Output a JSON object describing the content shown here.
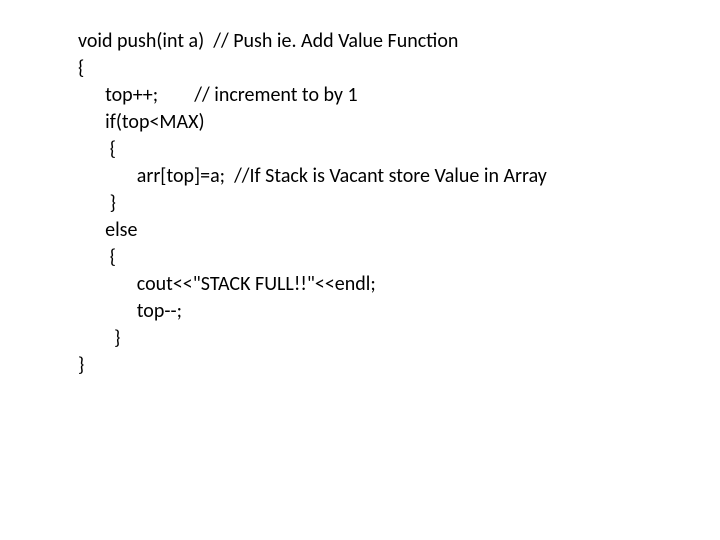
{
  "code": {
    "lines": [
      "void push(int a)  // Push ie. Add Value Function",
      "{",
      "      top++;        // increment to by 1",
      "      if(top<MAX)",
      "       {",
      "             arr[top]=a;  //If Stack is Vacant store Value in Array",
      "       }",
      "      else",
      "       {",
      "             cout<<\"STACK FULL!!\"<<endl;",
      "             top--;",
      "        }",
      "}"
    ]
  }
}
